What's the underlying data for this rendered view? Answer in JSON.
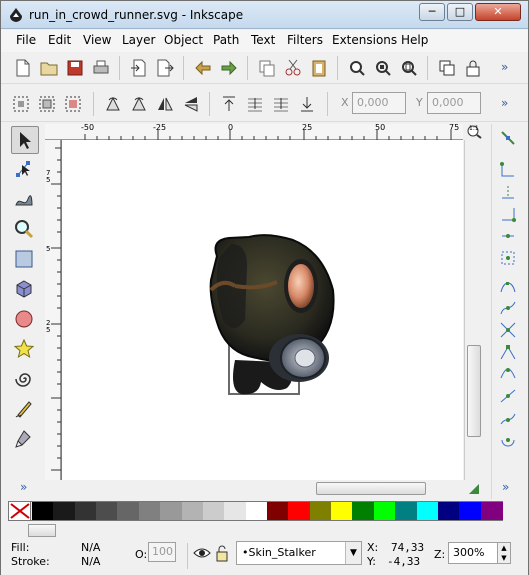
{
  "window": {
    "title": "run_in_crowd_runner.svg - Inkscape",
    "minimize": "─",
    "maximize": "□",
    "close": "✕"
  },
  "menu": [
    "File",
    "Edit",
    "View",
    "Layer",
    "Object",
    "Path",
    "Text",
    "Filters",
    "Extensions",
    "Help"
  ],
  "command_bar": {
    "icons": [
      "new-document-icon",
      "open-icon",
      "save-icon",
      "print-icon",
      "import-icon",
      "export-icon",
      "undo-icon",
      "redo-icon",
      "duplicate-icon",
      "cut-icon",
      "paste-icon",
      "zoom-selection-icon",
      "zoom-drawing-icon",
      "zoom-page-icon",
      "clone-icon",
      "lock-icon"
    ],
    "overflow": "»"
  },
  "tool_controls": {
    "x_label": "X",
    "x_value": "0,000",
    "y_label": "Y",
    "y_value": "0,000",
    "overflow": "»"
  },
  "ruler": {
    "h_ticks": [
      "-50",
      "-25",
      "0",
      "25",
      "50",
      "75"
    ],
    "v_ticks": [
      "7\n5",
      "5",
      "2\n5"
    ],
    "zoom_icon_label": "1:1"
  },
  "left_tools": [
    "selector-tool",
    "node-tool",
    "tweak-tool",
    "zoom-tool",
    "rectangle-tool",
    "3d-box-tool",
    "ellipse-tool",
    "star-tool",
    "spiral-tool",
    "pencil-tool",
    "pen-tool"
  ],
  "left_tools_overflow": "»",
  "right_tools_overflow": "»",
  "palette": {
    "colors": [
      "#000000",
      "#1a1a1a",
      "#333333",
      "#4d4d4d",
      "#666666",
      "#808080",
      "#999999",
      "#b3b3b3",
      "#cccccc",
      "#e6e6e6",
      "#ffffff",
      "#800000",
      "#ff0000",
      "#808000",
      "#ffff00",
      "#008000",
      "#00ff00",
      "#008080",
      "#00ffff",
      "#000080",
      "#0000ff",
      "#800080"
    ]
  },
  "status": {
    "fill_label": "Fill:",
    "fill_value": "N/A",
    "stroke_label": "Stroke:",
    "stroke_value": "N/A",
    "opacity_label": "O:",
    "opacity_value": "100",
    "layer_name": "•Skin_Stalker",
    "x_label": "X:",
    "x_value": "74,33",
    "y_label": "Y:",
    "y_value": "-4,33",
    "zoom_label": "Z:",
    "zoom_value": "300%"
  }
}
